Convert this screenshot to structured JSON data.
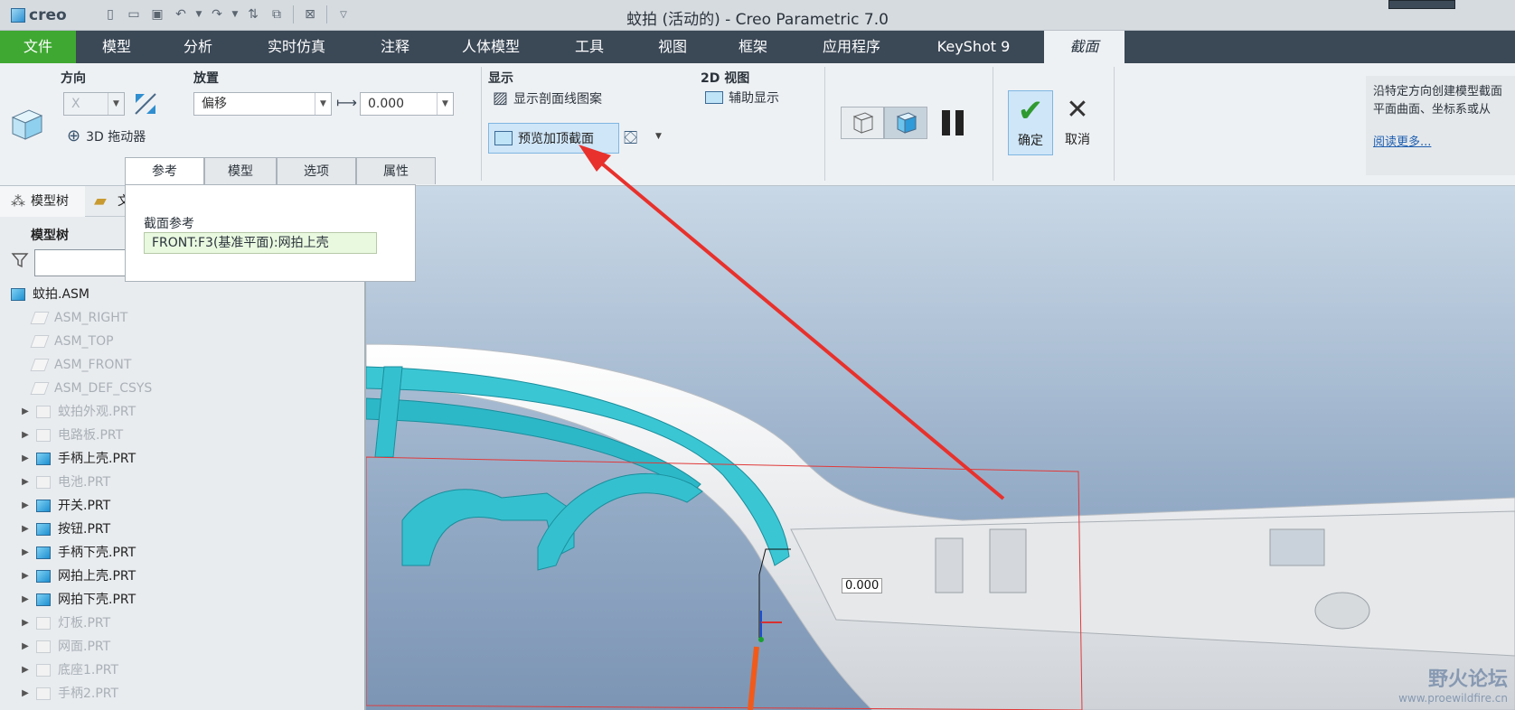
{
  "titlebar": {
    "logo": "creo",
    "title": "蚊拍 (活动的) - Creo Parametric 7.0"
  },
  "tabs": [
    "文件",
    "模型",
    "分析",
    "实时仿真",
    "注释",
    "人体模型",
    "工具",
    "视图",
    "框架",
    "应用程序",
    "KeyShot 9",
    "截面"
  ],
  "ribbon": {
    "direction": {
      "label": "方向",
      "axis_value": "X",
      "dragger_label": "3D 拖动器"
    },
    "placement": {
      "label": "放置",
      "type_value": "偏移",
      "offset_value": "0.000"
    },
    "display": {
      "label": "显示",
      "show_hatch": "显示剖面线图案",
      "preview_cap": "预览加顶截面"
    },
    "view2d": {
      "label": "2D 视图",
      "aux_display": "辅助显示"
    },
    "ok_label": "确定",
    "cancel_label": "取消",
    "help_line1": "沿特定方向创建模型截面",
    "help_line2": "平面曲面、坐标系或从",
    "help_link": "阅读更多..."
  },
  "subtabs": [
    "参考",
    "模型",
    "选项",
    "属性"
  ],
  "panel": {
    "label": "截面参考",
    "reference": "FRONT:F3(基准平面):网拍上壳"
  },
  "side": {
    "tab1": "模型树",
    "tab2": "文",
    "title": "模型树",
    "search_value": ""
  },
  "tree": [
    {
      "name": "蚊拍.ASM",
      "type": "asm",
      "expand": false
    },
    {
      "name": "ASM_RIGHT",
      "type": "plane",
      "expand": false
    },
    {
      "name": "ASM_TOP",
      "type": "plane",
      "expand": false
    },
    {
      "name": "ASM_FRONT",
      "type": "plane",
      "expand": false
    },
    {
      "name": "ASM_DEF_CSYS",
      "type": "csys",
      "expand": false
    },
    {
      "name": "蚊拍外观.PRT",
      "type": "off",
      "expand": true
    },
    {
      "name": "电路板.PRT",
      "type": "off",
      "expand": true
    },
    {
      "name": "手柄上壳.PRT",
      "type": "on",
      "expand": true
    },
    {
      "name": "电池.PRT",
      "type": "off",
      "expand": true
    },
    {
      "name": "开关.PRT",
      "type": "on",
      "expand": true
    },
    {
      "name": "按钮.PRT",
      "type": "on",
      "expand": true
    },
    {
      "name": "手柄下壳.PRT",
      "type": "on",
      "expand": true
    },
    {
      "name": "网拍上壳.PRT",
      "type": "on",
      "expand": true
    },
    {
      "name": "网拍下壳.PRT",
      "type": "on",
      "expand": true
    },
    {
      "name": "灯板.PRT",
      "type": "off",
      "expand": true
    },
    {
      "name": "网面.PRT",
      "type": "off",
      "expand": true
    },
    {
      "name": "底座1.PRT",
      "type": "off",
      "expand": true
    },
    {
      "name": "手柄2.PRT",
      "type": "off",
      "expand": true
    }
  ],
  "viewport": {
    "dimension": "0.000",
    "watermark_text": "野火论坛",
    "watermark_url": "www.proewildfire.cn"
  }
}
